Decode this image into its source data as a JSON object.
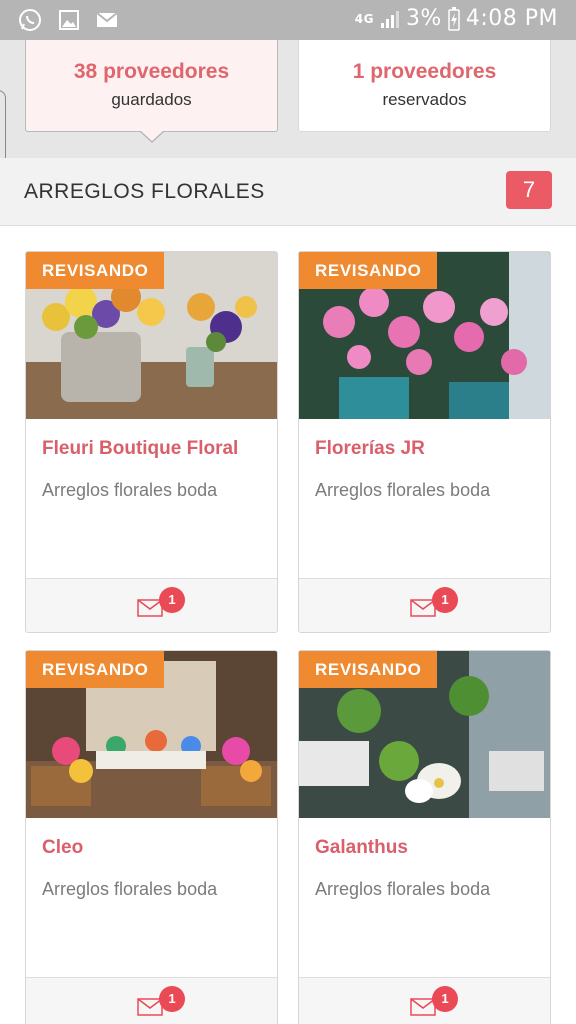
{
  "status_bar": {
    "network": "4G",
    "battery": "3%",
    "time": "4:08 PM",
    "icons": [
      "whatsapp-icon",
      "gallery-icon",
      "mail-icon",
      "signal-icon",
      "battery-charging-icon"
    ]
  },
  "summary": {
    "saved": {
      "count": "38 proveedores",
      "label": "guardados"
    },
    "booked": {
      "count": "1 proveedores",
      "label": "reservados"
    }
  },
  "category": {
    "title": "ARREGLOS FLORALES",
    "count": "7"
  },
  "cards": [
    {
      "status": "REVISANDO",
      "name": "Fleuri Boutique Floral",
      "category": "Arreglos florales boda",
      "messages": "1"
    },
    {
      "status": "REVISANDO",
      "name": "Florerías JR",
      "category": "Arreglos florales boda",
      "messages": "1"
    },
    {
      "status": "REVISANDO",
      "name": "Cleo",
      "category": "Arreglos florales boda",
      "messages": "1"
    },
    {
      "status": "REVISANDO",
      "name": "Galanthus",
      "category": "Arreglos florales boda",
      "messages": "1"
    }
  ],
  "colors": {
    "accent": "#e0666e",
    "badge_orange": "#ef8a30",
    "count_red": "#ea5b65",
    "status_bar": "#b5b5b5"
  }
}
